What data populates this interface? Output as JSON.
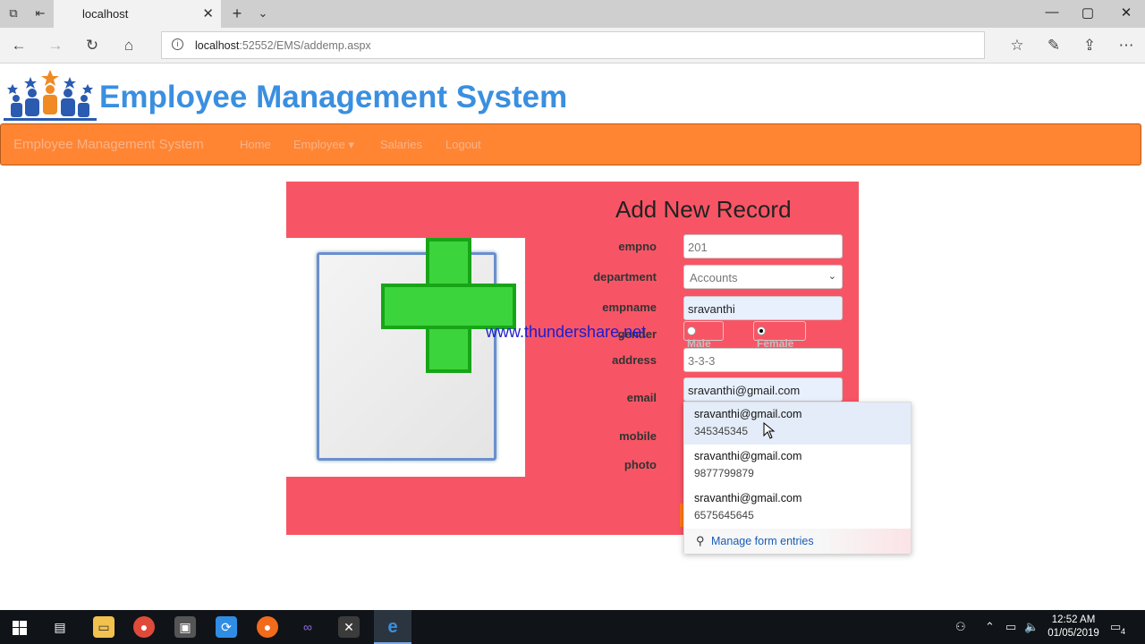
{
  "browser": {
    "tab_title": "localhost",
    "url_host": "localhost",
    "url_path": ":52552/EMS/addemp.aspx",
    "window_controls": [
      "—",
      "▢",
      "✕"
    ]
  },
  "site": {
    "title": "Employee Management System",
    "nav": {
      "brand": "Employee Management System",
      "items": [
        "Home",
        "Employee ▾",
        "Salaries",
        "Logout"
      ]
    }
  },
  "form": {
    "title": "Add New Record",
    "labels": {
      "empno": "empno",
      "department": "department",
      "empname": "empname",
      "gender": "gender",
      "address": "address",
      "email": "email",
      "mobile": "mobile",
      "photo": "photo"
    },
    "empno_value": "201",
    "department_value": "Accounts",
    "empname_value": "sravanthi",
    "gender_options": [
      "Male",
      "Female"
    ],
    "gender_selected": "Female",
    "address_value": "3-3-3",
    "email_value": "sravanthi@gmail.com"
  },
  "watermark": "www.thundershare.net",
  "autofill": {
    "entries": [
      {
        "email": "sravanthi@gmail.com",
        "phone": "345345345"
      },
      {
        "email": "sravanthi@gmail.com",
        "phone": "9877799879"
      },
      {
        "email": "sravanthi@gmail.com",
        "phone": "6575645645"
      }
    ],
    "manage_label": "Manage form entries"
  },
  "taskbar": {
    "time": "12:52 AM",
    "date": "01/05/2019",
    "notification_count": "4"
  },
  "colors": {
    "site_title": "#3a8fe0",
    "nav_bar": "#ff8533",
    "form_panel": "#f75565"
  }
}
